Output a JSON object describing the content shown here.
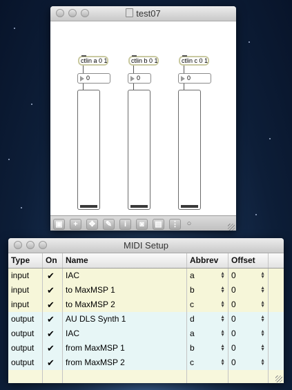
{
  "patcher": {
    "title": "test07",
    "objects": [
      {
        "ctlin": "ctlin a 0 1",
        "number": "0"
      },
      {
        "ctlin": "ctlin b 0 1",
        "number": "0"
      },
      {
        "ctlin": "ctlin c 0 1",
        "number": "0"
      }
    ],
    "toolbar": [
      "lock-icon",
      "new-object-icon",
      "move-icon",
      "draw-icon",
      "info-icon",
      "inspector-icon",
      "presentation-icon",
      "grid-icon",
      "options-icon"
    ]
  },
  "midi": {
    "title": "MIDI Setup",
    "columns": [
      "Type",
      "On",
      "Name",
      "Abbrev",
      "Offset"
    ],
    "rows": [
      {
        "type": "input",
        "on": true,
        "name": "IAC",
        "abbrev": "a",
        "offset": "0"
      },
      {
        "type": "input",
        "on": true,
        "name": "to MaxMSP 1",
        "abbrev": "b",
        "offset": "0"
      },
      {
        "type": "input",
        "on": true,
        "name": "to MaxMSP 2",
        "abbrev": "c",
        "offset": "0"
      },
      {
        "type": "output",
        "on": true,
        "name": "AU DLS Synth 1",
        "abbrev": "d",
        "offset": "0"
      },
      {
        "type": "output",
        "on": true,
        "name": "IAC",
        "abbrev": "a",
        "offset": "0"
      },
      {
        "type": "output",
        "on": true,
        "name": "from MaxMSP 1",
        "abbrev": "b",
        "offset": "0"
      },
      {
        "type": "output",
        "on": true,
        "name": "from MaxMSP 2",
        "abbrev": "c",
        "offset": "0"
      }
    ],
    "check_glyph": "✔"
  }
}
